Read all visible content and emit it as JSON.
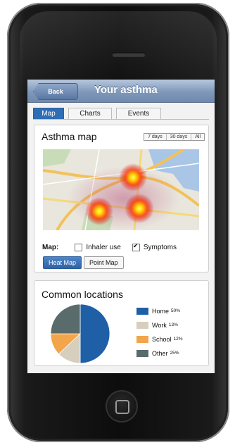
{
  "navbar": {
    "back_label": "Back",
    "title": "Your asthma"
  },
  "tabs": [
    {
      "label": "Map",
      "active": true
    },
    {
      "label": "Charts",
      "active": false
    },
    {
      "label": "Events",
      "active": false
    }
  ],
  "map_card": {
    "title": "Asthma map",
    "range_options": [
      "7 days",
      "30 days",
      "All"
    ],
    "filter_label": "Map:",
    "filters": [
      {
        "label": "Inhaler use",
        "checked": false
      },
      {
        "label": "Symptoms",
        "checked": true
      }
    ],
    "view_buttons": [
      {
        "label": "Heat Map",
        "active": true
      },
      {
        "label": "Point Map",
        "active": false
      }
    ]
  },
  "locations_card": {
    "title": "Common locations",
    "items": [
      {
        "label": "Home",
        "percent": "50%",
        "value": 50,
        "color": "#1f5fa6"
      },
      {
        "label": "Work",
        "percent": "13%",
        "value": 13,
        "color": "#d6cfbd"
      },
      {
        "label": "School",
        "percent": "12%",
        "value": 12,
        "color": "#f2a54a"
      },
      {
        "label": "Other",
        "percent": "25%",
        "value": 25,
        "color": "#5a6b6b"
      }
    ]
  },
  "icons": [
    "back-arrow-icon",
    "checkbox-icon",
    "home-button-icon"
  ]
}
